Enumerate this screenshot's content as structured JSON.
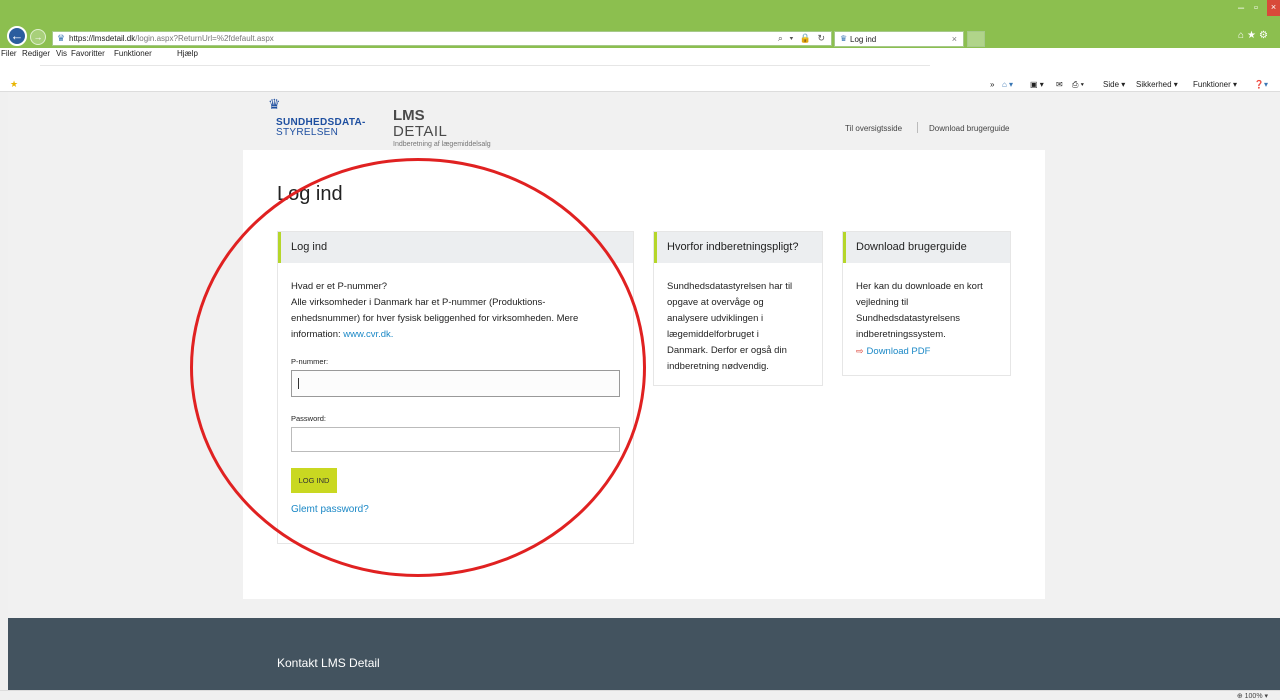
{
  "browser": {
    "url_host": "https://lmsdetail.dk",
    "url_path": "/login.aspx?ReturnUrl=%2fdefault.aspx",
    "tab_title": "Log ind",
    "tab_close": "×",
    "addr_tools": "⌕ ▾ 🔒 ↻",
    "menu": [
      "Filer",
      "Rediger",
      "Vis",
      "Favoritter",
      "Funktioner",
      "Hjælp"
    ],
    "commandbar": {
      "side": "Side ▾",
      "sikkerhed": "Sikkerhed ▾",
      "funktioner": "Funktioner ▾"
    },
    "zoom": "⊕ 100%  ▾"
  },
  "header": {
    "logo_line1": "SUNDHEDSDATA-",
    "logo_line2": "STYRELSEN",
    "app_name_1": "LMS",
    "app_name_2": "DETAIL",
    "app_subtitle": "Indberetning af lægemiddelsalg",
    "link_overview": "Til oversigtsside",
    "link_guide": "Download brugerguide"
  },
  "page": {
    "title": "Log ind"
  },
  "login_card": {
    "title": "Log ind",
    "question": "Hvad er et P-nummer?",
    "line1": "Alle virksomheder i Danmark har et P-nummer (Produktions-",
    "line2": "enhedsnummer) for hver fysisk beliggenhed for virksomheden. Mere",
    "line3_prefix": "information: ",
    "line3_link": "www.cvr.dk.",
    "p_label": "P-nummer:",
    "p_value": "",
    "password_label": "Password:",
    "password_value": "",
    "button": "LOG IND",
    "forgot": "Glemt password?"
  },
  "why_card": {
    "title": "Hvorfor indberetningspligt?",
    "lines": [
      "Sundhedsdatastyrelsen har til",
      "opgave at overvåge og",
      "analysere udviklingen i",
      "lægemiddelforbruget i",
      "Danmark. Derfor er også din",
      "indberetning nødvendig."
    ]
  },
  "download_card": {
    "title": "Download brugerguide",
    "lines": [
      "Her kan du downloade en kort",
      "vejledning til",
      "Sundhedsdatastyrelsens",
      "indberetningssystem."
    ],
    "pdf_link": "Download PDF"
  },
  "footer": {
    "text": "Kontakt LMS Detail"
  },
  "colors": {
    "accent": "#c9d821",
    "link": "#1b88c6",
    "footer": "#43535f",
    "annotation": "#e02121"
  }
}
